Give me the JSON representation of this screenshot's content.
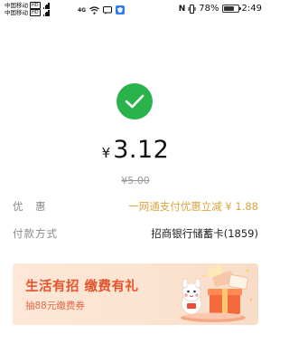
{
  "status_bar": {
    "carrier_1": "中国移动",
    "carrier_2": "中国移动",
    "hd_label": "HD",
    "network_type": "4G",
    "nfc": "N",
    "battery_percent": "78%",
    "battery_level": 0.78,
    "time": "2:49"
  },
  "payment": {
    "currency_symbol": "¥",
    "amount": "3.12",
    "original_amount": "¥5.00",
    "discount_label": "优　惠",
    "discount_value": "一网通支付优惠立减 ¥ 1.88",
    "method_label": "付款方式",
    "method_value": "招商银行储蓄卡(1859)"
  },
  "banner": {
    "title": "生活有招 缴费有礼",
    "subtitle": "抽88元缴费券"
  },
  "colors": {
    "success_green": "#2bb34b",
    "discount_gold": "#d9a640",
    "banner_red": "#e4532c"
  },
  "icons": {
    "success": "checkmark-icon",
    "wifi": "wifi-icon",
    "signal": "signal-icon",
    "battery": "battery-icon",
    "nfc": "nfc-icon",
    "message": "message-icon",
    "app": "shield-app-icon"
  }
}
